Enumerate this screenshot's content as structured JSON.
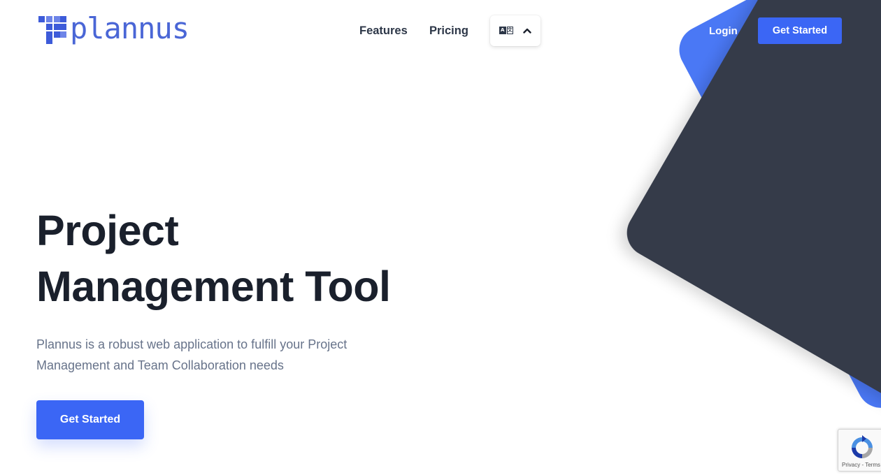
{
  "colors": {
    "accent_blue": "#3b66f5",
    "shape_blue": "#4a78f5",
    "shape_dark": "#353a48",
    "heading": "#1a202c",
    "muted_text": "#67738a",
    "logo_blue": "#4a66d6"
  },
  "brand": {
    "name": "plannus"
  },
  "nav": {
    "features": "Features",
    "pricing": "Pricing",
    "language_icon": "translate-icon",
    "language_chevron": "chevron-up-icon"
  },
  "header": {
    "login": "Login",
    "get_started": "Get Started"
  },
  "hero": {
    "title_line1": "Project",
    "title_line2": "Management Tool",
    "description": "Plannus is a robust web application to fulfill your Project Management and Team Collaboration needs",
    "cta": "Get Started"
  },
  "recaptcha": {
    "privacy": "Privacy",
    "separator": " - ",
    "terms": "Terms"
  }
}
